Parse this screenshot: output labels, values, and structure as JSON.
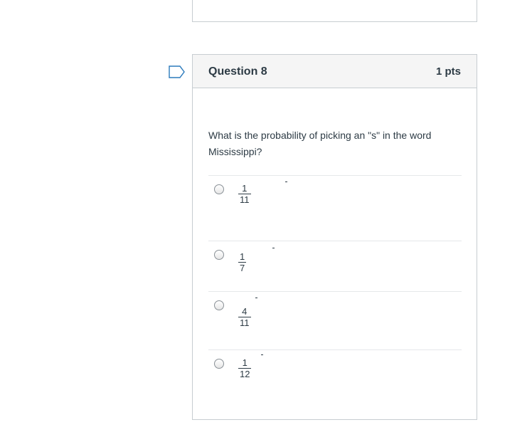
{
  "question": {
    "title": "Question 8",
    "points": "1 pts",
    "text": "What is the probability of picking an \"s\" in the word Mississippi?"
  },
  "answers": [
    {
      "numerator": "1",
      "denominator": "11"
    },
    {
      "numerator": "1",
      "denominator": "7"
    },
    {
      "numerator": "4",
      "denominator": "11"
    },
    {
      "numerator": "1",
      "denominator": "12"
    }
  ],
  "colors": {
    "border": "#c7cdd1",
    "header_bg": "#f5f5f5",
    "text": "#2d3b45",
    "flag": "#2b7abc"
  },
  "icons": {
    "flag": "bookmark-flag-icon"
  }
}
